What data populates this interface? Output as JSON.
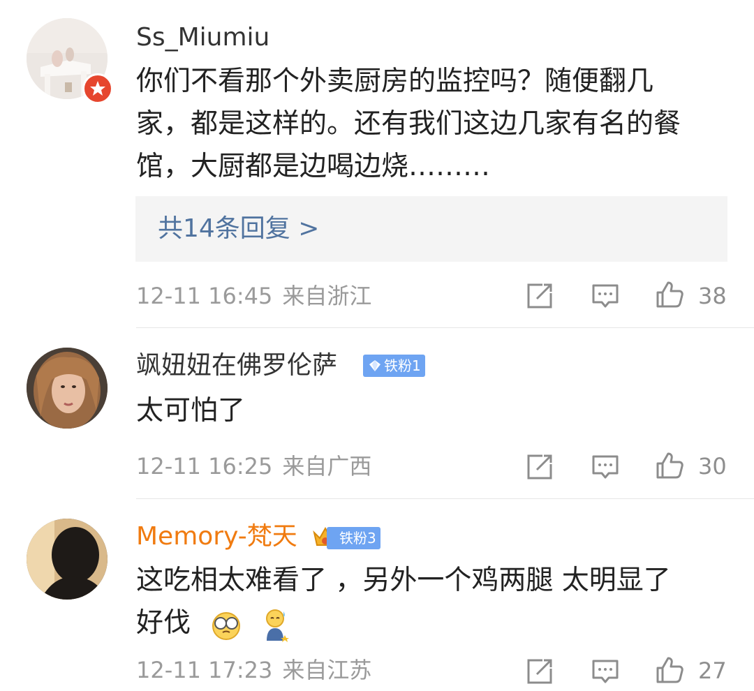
{
  "comments": [
    {
      "username": "Ss_Miumiu",
      "line1": "你们不看那个外卖厨房的监控吗？随便翻几",
      "line2": "家，都是这样的。还有我们这边几家有名的餐",
      "line3": "馆，大厨都是边喝边烧………",
      "replies": "共14条回复 >",
      "time": "12-11 16:45",
      "location": "来自浙江",
      "likes": "38",
      "avatar_badge": "star-badge"
    },
    {
      "username": "飒妞妞在佛罗伦萨",
      "badge": "铁粉1",
      "line1": "太可怕了",
      "time": "12-11 16:25",
      "location": "来自广西",
      "likes": "30"
    },
    {
      "username": "Memory-梵天",
      "badge": "铁粉3",
      "line1": "这吃相太难看了 ，另外一个鸡两腿 太明显了",
      "line2": "好伐",
      "emojis": [
        "glasses-face-emoji",
        "sweating-person-emoji"
      ],
      "time": "12-11 17:23",
      "location": "来自江苏",
      "likes": "27"
    }
  ],
  "icons": [
    "share-icon",
    "comment-icon",
    "like-icon"
  ],
  "colors": {
    "reply_link": "#50739f",
    "vip_name": "#f07b10",
    "fan_badge": "#6ea4f2",
    "meta_text": "#9a9a9a"
  }
}
